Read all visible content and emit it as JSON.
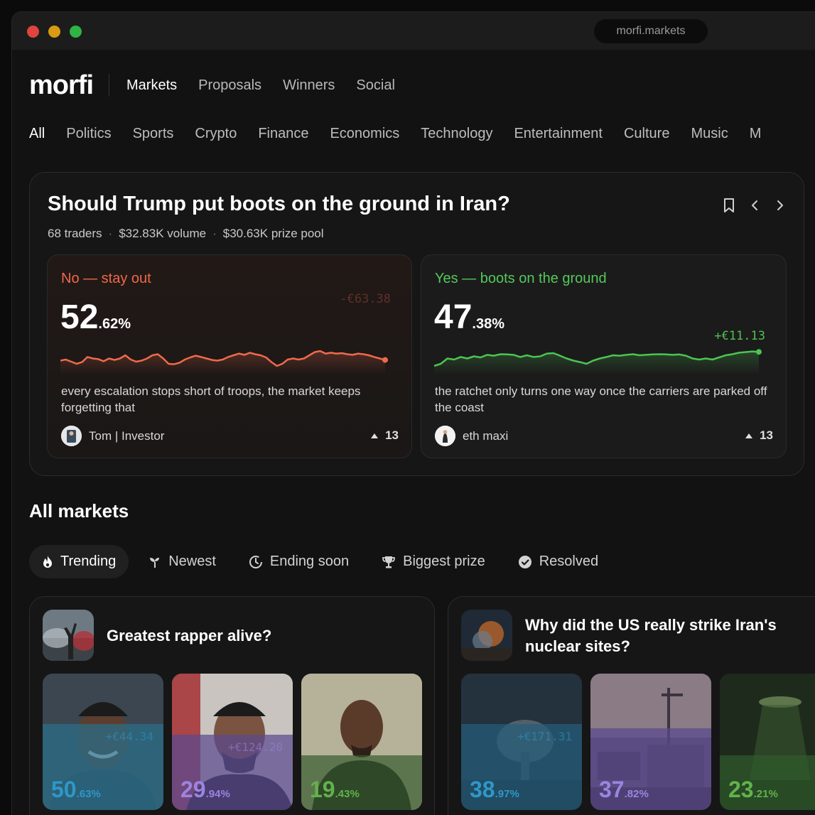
{
  "browser": {
    "url": "morfi.markets"
  },
  "brand": {
    "logo": "morfi"
  },
  "nav": [
    {
      "label": "Markets",
      "active": true
    },
    {
      "label": "Proposals",
      "active": false
    },
    {
      "label": "Winners",
      "active": false
    },
    {
      "label": "Social",
      "active": false
    }
  ],
  "categories": [
    "All",
    "Politics",
    "Sports",
    "Crypto",
    "Finance",
    "Economics",
    "Technology",
    "Entertainment",
    "Culture",
    "Music",
    "M"
  ],
  "hero": {
    "title": "Should Trump put boots on the ground in Iran?",
    "traders": "68 traders",
    "volume": "$32.83K volume",
    "prize": "$30.63K prize pool",
    "meta_sep": "·",
    "options": [
      {
        "label": "No — stay out",
        "pct_int": "52",
        "pct_dec": ".62",
        "pct_unit": "%",
        "delta": "-€63.38",
        "quote": "every escalation stops short of troops, the market keeps forgetting that",
        "author": "Tom | Investor",
        "votes": "13",
        "spark": [
          0.45,
          0.5,
          0.4,
          0.3,
          0.38,
          0.62,
          0.55,
          0.52,
          0.42,
          0.55,
          0.48,
          0.55,
          0.7,
          0.5,
          0.4,
          0.45,
          0.55,
          0.7,
          0.75,
          0.55,
          0.3,
          0.28,
          0.35,
          0.5,
          0.6,
          0.68,
          0.62,
          0.55,
          0.48,
          0.45,
          0.5,
          0.62,
          0.7,
          0.78,
          0.72,
          0.82,
          0.75,
          0.7,
          0.6,
          0.38,
          0.2,
          0.3,
          0.5,
          0.55,
          0.5,
          0.55,
          0.7,
          0.85,
          0.9,
          0.78,
          0.82,
          0.78,
          0.8,
          0.75,
          0.72,
          0.78,
          0.75,
          0.7,
          0.62,
          0.55,
          0.48
        ]
      },
      {
        "label": "Yes — boots on the ground",
        "pct_int": "47",
        "pct_dec": ".38",
        "pct_unit": "%",
        "delta": "+€11.13",
        "quote": "the ratchet only turns one way once the carriers are parked off the coast",
        "author": "eth maxi",
        "votes": "13",
        "spark": [
          0.2,
          0.3,
          0.55,
          0.5,
          0.62,
          0.55,
          0.65,
          0.6,
          0.72,
          0.68,
          0.75,
          0.74,
          0.72,
          0.62,
          0.7,
          0.62,
          0.65,
          0.78,
          0.8,
          0.68,
          0.55,
          0.45,
          0.38,
          0.3,
          0.45,
          0.55,
          0.62,
          0.7,
          0.68,
          0.72,
          0.75,
          0.7,
          0.72,
          0.74,
          0.75,
          0.74,
          0.72,
          0.74,
          0.68,
          0.55,
          0.5,
          0.55,
          0.5,
          0.6,
          0.7,
          0.75,
          0.82,
          0.85,
          0.88,
          0.86
        ]
      }
    ]
  },
  "all_markets": {
    "title": "All markets",
    "filters": [
      {
        "label": "Trending",
        "icon": "flame-icon",
        "active": true
      },
      {
        "label": "Newest",
        "icon": "sprout-icon",
        "active": false
      },
      {
        "label": "Ending soon",
        "icon": "clock-icon",
        "active": false
      },
      {
        "label": "Biggest prize",
        "icon": "trophy-icon",
        "active": false
      },
      {
        "label": "Resolved",
        "icon": "check-circle-icon",
        "active": false
      }
    ],
    "cards": [
      {
        "title": "Greatest rapper alive?",
        "tiles": [
          {
            "pct_int": "50",
            "pct_dec": ".63%",
            "delta": "+€44.34",
            "level": 0.63,
            "color": "#2a6f8a",
            "text_color": "#2f97c7"
          },
          {
            "pct_int": "29",
            "pct_dec": ".94%",
            "delta": "+€124.20",
            "level": 0.55,
            "color": "#5b4a8f",
            "text_color": "#9c84e0"
          },
          {
            "pct_int": "19",
            "pct_dec": ".43%",
            "delta": "",
            "level": 0.4,
            "color": "#3a5d31",
            "text_color": "#62b24c"
          }
        ]
      },
      {
        "title": "Why did the US really strike Iran's nuclear sites?",
        "tiles": [
          {
            "pct_int": "38",
            "pct_dec": ".97%",
            "delta": "+€171.31",
            "level": 0.63,
            "color": "#245d7a",
            "text_color": "#2f97c7"
          },
          {
            "pct_int": "37",
            "pct_dec": ".82%",
            "delta": "",
            "level": 0.6,
            "color": "#5b4a8f",
            "text_color": "#9c84e0"
          },
          {
            "pct_int": "23",
            "pct_dec": ".21%",
            "delta": "",
            "level": 0.4,
            "color": "#2f5a2c",
            "text_color": "#62b24c"
          }
        ]
      }
    ]
  }
}
